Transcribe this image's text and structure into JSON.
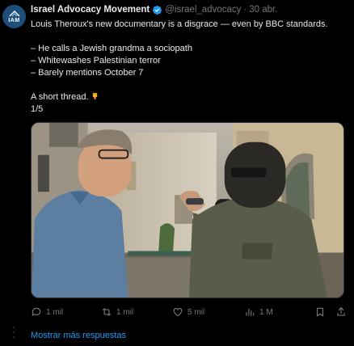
{
  "tweet": {
    "avatar_text": "IAM",
    "author_name": "Israel Advocacy Movement",
    "handle": "@israel_advocacy",
    "separator": "·",
    "timestamp": "30 abr.",
    "lines": [
      "Louis Theroux's new documentary is a disgrace — even by BBC standards.",
      "",
      "– He calls a Jewish grandma a sociopath",
      "– Whitewashes Palestinian terror",
      "– Barely mentions October 7",
      "",
      "A short thread."
    ],
    "thread_count": "1/5",
    "pointing_emoji": "point-down-emoji",
    "media": {
      "type": "video-still",
      "description_icon": "video-frame"
    },
    "actions": {
      "replies": "1 mil",
      "retweets": "1 mil",
      "likes": "5 mil",
      "views": "1 M"
    }
  },
  "more_replies_label": "Mostrar más respuestas",
  "colors": {
    "background": "#000000",
    "text": "#e7e9ea",
    "muted": "#71767b",
    "accent": "#1d9bf0",
    "verified": "#1d9bf0"
  }
}
